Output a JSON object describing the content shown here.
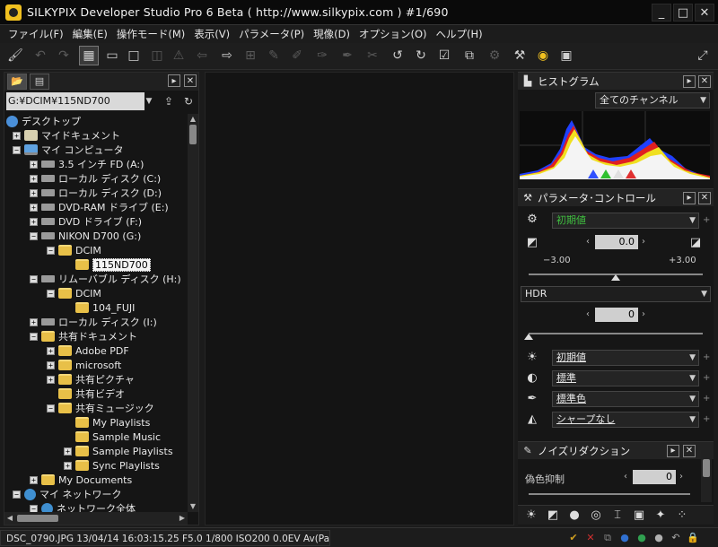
{
  "window": {
    "title": "SILKYPIX Developer Studio Pro 6 Beta ( http://www.silkypix.com )  #1/690",
    "controls": [
      "_",
      "□",
      "✕"
    ]
  },
  "menu": [
    "ファイル(F)",
    "編集(E)",
    "操作モード(M)",
    "表示(V)",
    "パラメータ(P)",
    "現像(D)",
    "オプション(O)",
    "ヘルプ(H)"
  ],
  "left_panel": {
    "path": "G:¥DCIM¥115ND700",
    "tree": [
      {
        "label": "デスクトップ",
        "level": 0,
        "icon": "desktop-icon",
        "exp": ""
      },
      {
        "label": "マイドキュメント",
        "level": 1,
        "icon": "documents-icon",
        "exp": "+"
      },
      {
        "label": "マイ コンピュータ",
        "level": 1,
        "icon": "computer-icon",
        "exp": "−"
      },
      {
        "label": "3.5 インチ FD (A:)",
        "level": 2,
        "icon": "drive-icon",
        "exp": "+"
      },
      {
        "label": "ローカル ディスク (C:)",
        "level": 2,
        "icon": "drive-icon",
        "exp": "+"
      },
      {
        "label": "ローカル ディスク (D:)",
        "level": 2,
        "icon": "drive-icon",
        "exp": "+"
      },
      {
        "label": "DVD-RAM ドライブ (E:)",
        "level": 2,
        "icon": "drive-icon",
        "exp": "+"
      },
      {
        "label": "DVD ドライブ (F:)",
        "level": 2,
        "icon": "drive-icon",
        "exp": "+"
      },
      {
        "label": "NIKON D700 (G:)",
        "level": 2,
        "icon": "drive-icon",
        "exp": "−"
      },
      {
        "label": "DCIM",
        "level": 3,
        "icon": "folder-icon",
        "exp": "−"
      },
      {
        "label": "115ND700",
        "level": 4,
        "icon": "folder-icon",
        "exp": "",
        "selected": true
      },
      {
        "label": "リムーバブル ディスク (H:)",
        "level": 2,
        "icon": "drive-icon",
        "exp": "−"
      },
      {
        "label": "DCIM",
        "level": 3,
        "icon": "folder-icon",
        "exp": "−"
      },
      {
        "label": "104_FUJI",
        "level": 4,
        "icon": "folder-icon",
        "exp": ""
      },
      {
        "label": "ローカル ディスク (I:)",
        "level": 2,
        "icon": "drive-icon",
        "exp": "+"
      },
      {
        "label": "共有ドキュメント",
        "level": 2,
        "icon": "folder-icon",
        "exp": "−"
      },
      {
        "label": "Adobe PDF",
        "level": 3,
        "icon": "folder-icon",
        "exp": "+"
      },
      {
        "label": "microsoft",
        "level": 3,
        "icon": "folder-icon",
        "exp": "+"
      },
      {
        "label": "共有ピクチャ",
        "level": 3,
        "icon": "folder-icon",
        "exp": "+"
      },
      {
        "label": "共有ビデオ",
        "level": 3,
        "icon": "folder-icon",
        "exp": ""
      },
      {
        "label": "共有ミュージック",
        "level": 3,
        "icon": "folder-icon",
        "exp": "−"
      },
      {
        "label": "My Playlists",
        "level": 4,
        "icon": "folder-icon",
        "exp": ""
      },
      {
        "label": "Sample Music",
        "level": 4,
        "icon": "folder-icon",
        "exp": ""
      },
      {
        "label": "Sample Playlists",
        "level": 4,
        "icon": "folder-icon",
        "exp": "+"
      },
      {
        "label": "Sync Playlists",
        "level": 4,
        "icon": "folder-icon",
        "exp": "+"
      },
      {
        "label": "My Documents",
        "level": 2,
        "icon": "folder-icon",
        "exp": "+"
      },
      {
        "label": "マイ ネットワーク",
        "level": 1,
        "icon": "network-icon",
        "exp": "−"
      },
      {
        "label": "ネットワーク全体",
        "level": 2,
        "icon": "network-icon",
        "exp": "−"
      }
    ]
  },
  "histogram": {
    "title": "ヒストグラム",
    "channel": "全てのチャンネル"
  },
  "params": {
    "title": "パラメータ･コントロール",
    "preset": "初期値",
    "exposure_value": "0.0",
    "exposure_min": "−3.00",
    "exposure_max": "+3.00",
    "exposure_level": 0.5,
    "hdr_label": "HDR",
    "hdr_value": "0",
    "hdr_level": 0.0,
    "wb": "初期値",
    "tone": "標準",
    "color": "標準色",
    "sharpness": "シャープなし"
  },
  "noise": {
    "title": "ノイズリダクション",
    "false_color_label": "偽色抑制",
    "false_color_value": "0"
  },
  "status": {
    "text": "DSC_0790.JPG 13/04/14 16:03:15.25  F5.0  1/800  ISO200   0.0EV  Av(Pa..."
  },
  "colors": {
    "accent_green": "#3fbf3f",
    "background": "#1b1b1b"
  }
}
